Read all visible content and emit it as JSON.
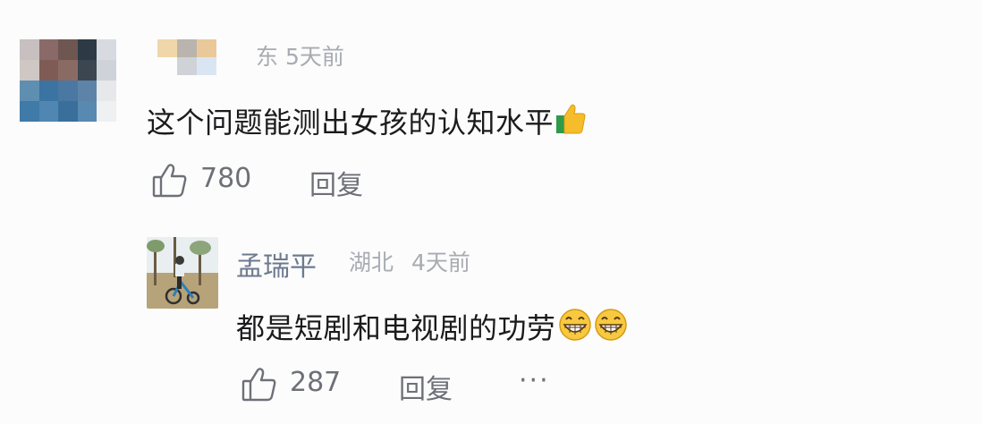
{
  "comment": {
    "location_time": "东 5天前",
    "text": "这个问题能测出女孩的认知水平",
    "emoji": "thumbs-up",
    "likes": "780",
    "reply_label": "回复"
  },
  "reply": {
    "username": "孟瑞平",
    "location": "湖北",
    "time": "4天前",
    "text": "都是短剧和电视剧的功劳",
    "emojis": [
      "grinning-face",
      "grinning-face"
    ],
    "likes": "287",
    "reply_label": "回复",
    "more_label": "···"
  }
}
